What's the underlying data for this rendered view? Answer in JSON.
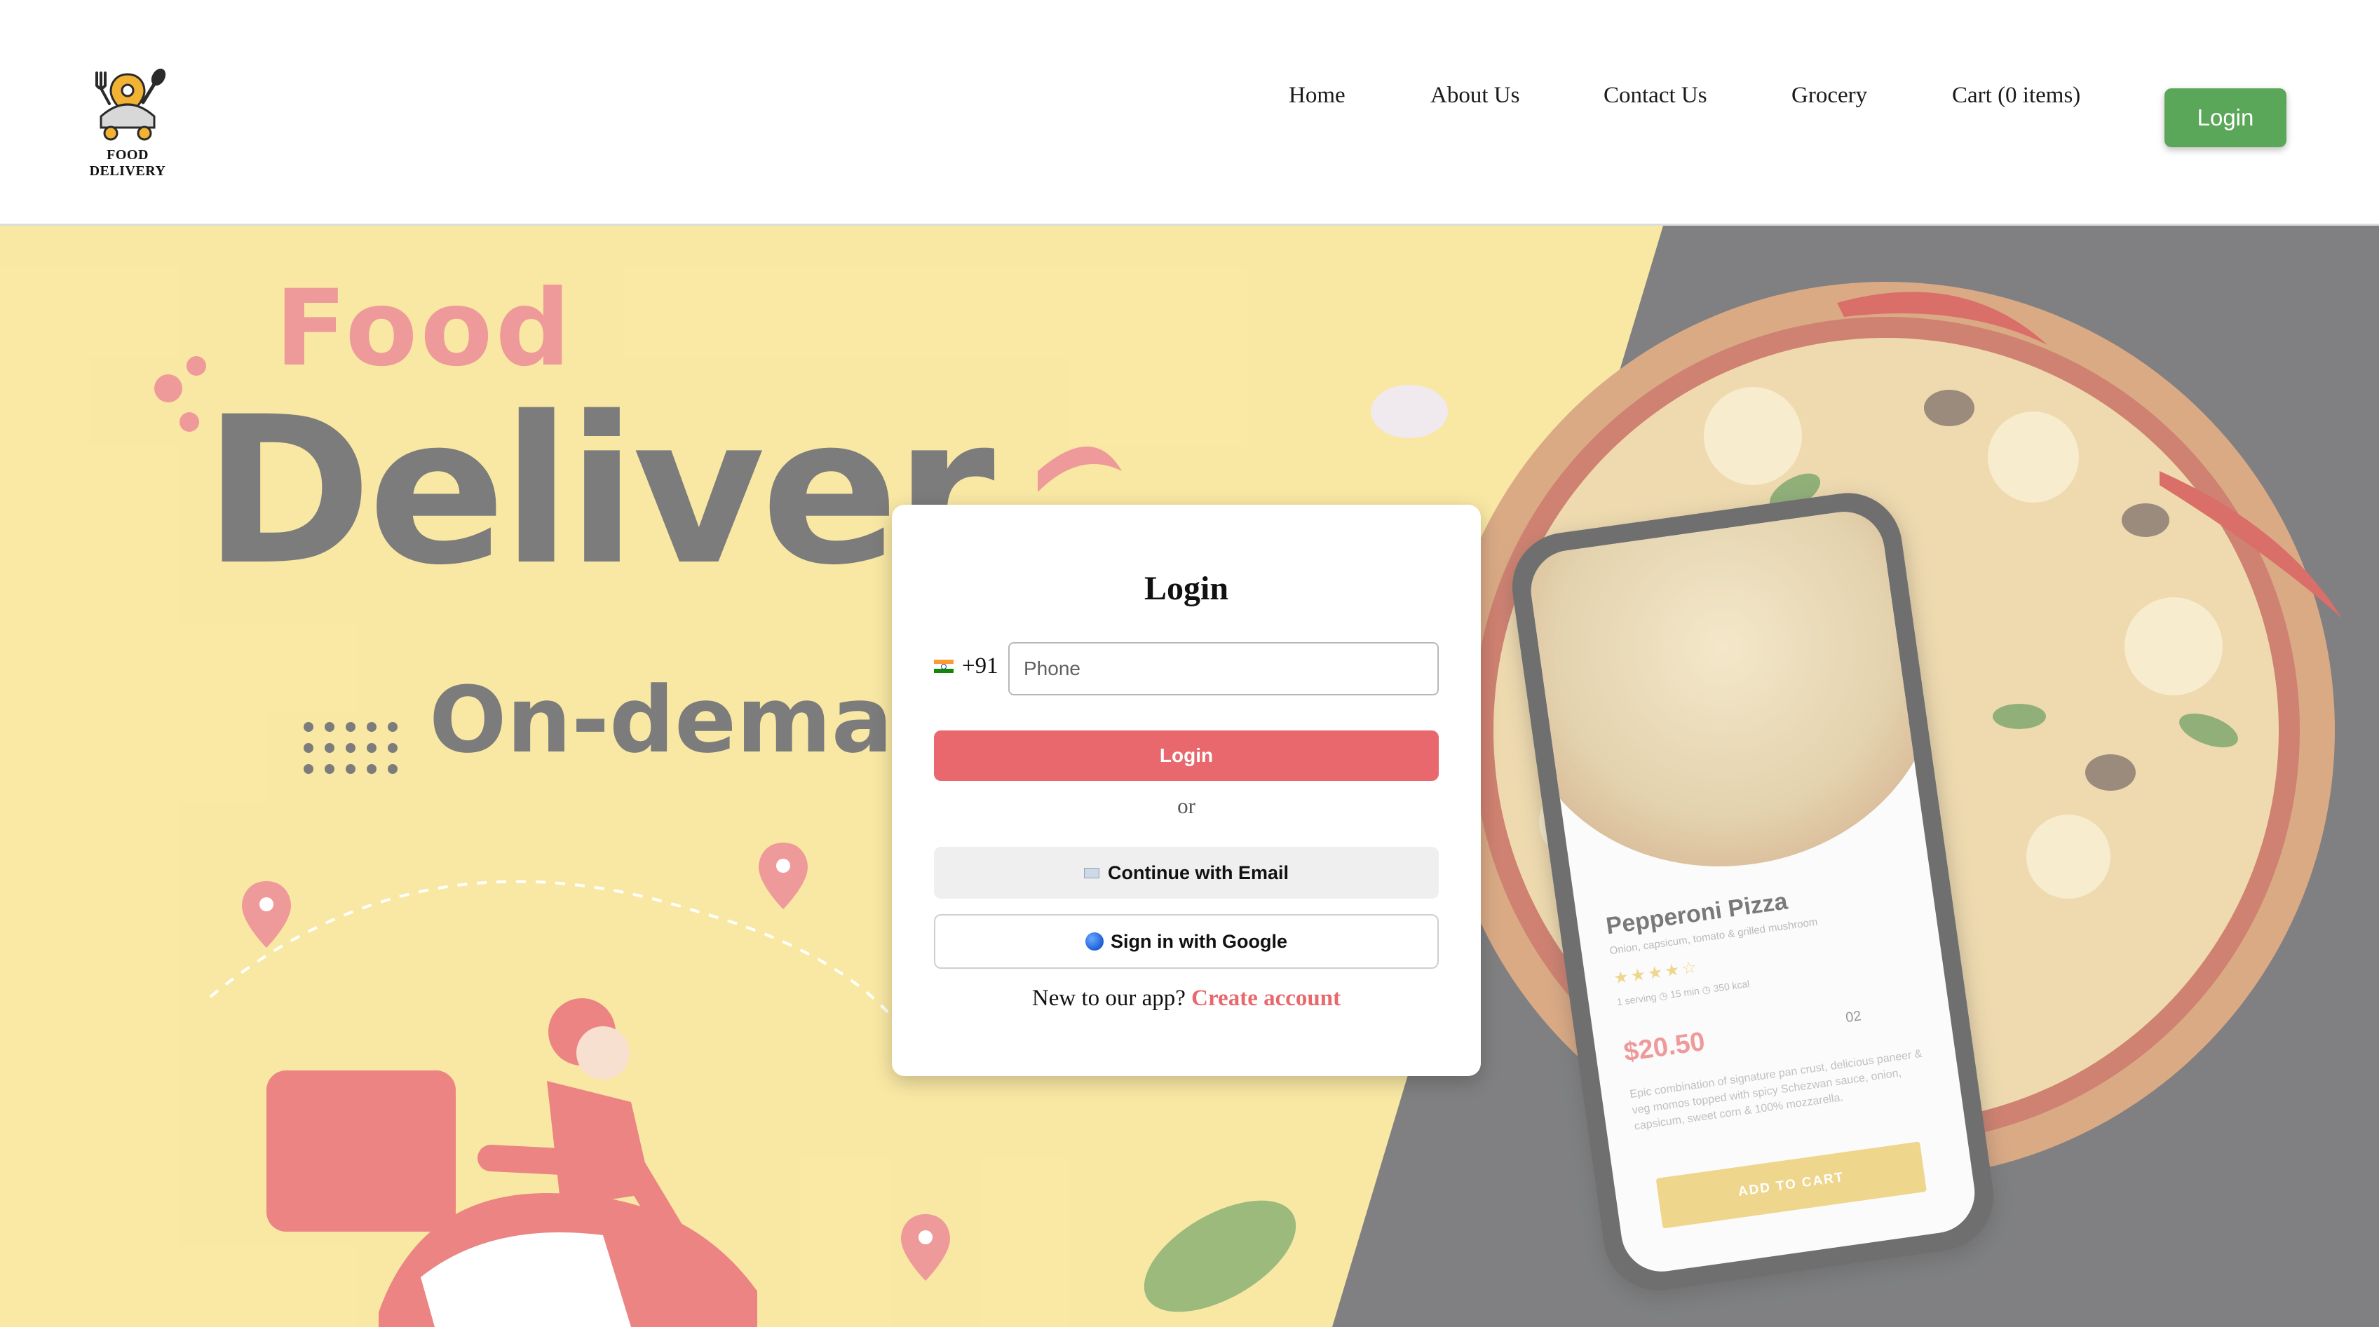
{
  "header": {
    "logo_text": "FOOD DELIVERY",
    "nav": [
      {
        "label": "Home"
      },
      {
        "label": "About Us"
      },
      {
        "label": "Contact Us"
      },
      {
        "label": "Grocery"
      },
      {
        "label": "Cart (0 items)"
      }
    ],
    "login_label": "Login"
  },
  "hero": {
    "title_food": "Food",
    "title_deliver": "Deliver",
    "title_ondemand": "On-demand",
    "phone_app": {
      "product_name": "Pepperoni Pizza",
      "product_subtitle": "Onion, capsicum, tomato & grilled mushroom",
      "stars": "★★★★☆",
      "meta": "1 serving   ◷ 15 min   ◷ 350 kcal",
      "price": "$20.50",
      "quantity": "02",
      "description": "Epic combination of signature pan crust, delicious paneer & veg momos topped with spicy Schezwan sauce, onion, capsicum, sweet corn & 100% mozzarella.",
      "add_to_cart": "ADD TO CART"
    },
    "scooter_text": "Delivery"
  },
  "login_card": {
    "title": "Login",
    "country_code": "+91",
    "phone_placeholder": "Phone",
    "login_button": "Login",
    "or_text": "or",
    "email_button": "Continue with Email",
    "google_button": "Sign in with Google",
    "new_user_text": "New to our app?",
    "create_account": "Create account"
  },
  "colors": {
    "nav_login_bg": "#5aa75a",
    "card_login_bg": "#e8686d",
    "hero_yellow": "#f7dd7a",
    "hero_dark": "#444547",
    "accent_red": "#e86a6a"
  },
  "icons": {
    "logo": "delivery-cart-icon",
    "flag": "india-flag-icon",
    "email": "mail-icon",
    "google": "globe-icon"
  }
}
